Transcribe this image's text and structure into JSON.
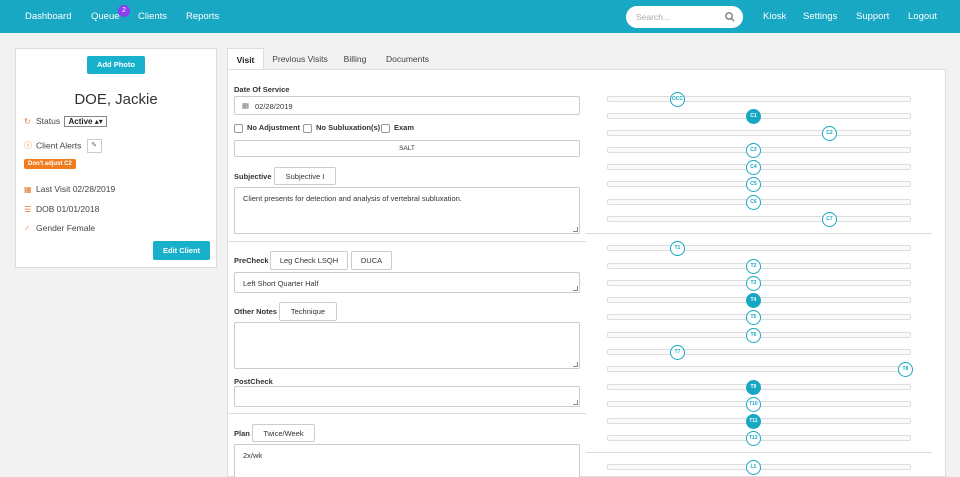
{
  "nav": {
    "items": [
      "Dashboard",
      "Queue",
      "Clients",
      "Reports",
      "Kiosk",
      "Settings",
      "Support",
      "Logout"
    ],
    "queue_badge": "2",
    "search_placeholder": "Search..."
  },
  "client": {
    "add_photo": "Add Photo",
    "name": "DOE, Jackie",
    "status_label": "Status",
    "status_value": "Active",
    "alerts_label": "Client Alerts",
    "alert_badge": "Don't adjust C2",
    "last_visit": "Last Visit 02/28/2019",
    "dob": "DOB 01/01/2018",
    "gender": "Gender Female",
    "edit_button": "Edit Client"
  },
  "tabs": [
    "Visit",
    "Previous Visits",
    "Billing",
    "Documents"
  ],
  "visit": {
    "date_label": "Date Of Service",
    "date_value": "02/28/2019",
    "checkboxes": [
      "No Adjustment",
      "No Subluxation(s)",
      "Exam"
    ],
    "salt": "SALT",
    "subjective_label": "Subjective",
    "subjective_button": "Subjective I",
    "subjective_text": "Client presents for detection and analysis of vertebral subluxation.",
    "precheck_label": "PreCheck",
    "precheck_buttons": [
      "Leg Check LSQH",
      "DUCA"
    ],
    "precheck_text": "Left Short Quarter Half",
    "other_label": "Other Notes",
    "other_button": "Technique",
    "postcheck_label": "PostCheck",
    "plan_label": "Plan",
    "plan_button": "Twice/Week",
    "plan_text": "2x/wk"
  },
  "spine": [
    {
      "label": "OCC",
      "pos": 0.23,
      "filled": false
    },
    {
      "label": "C1",
      "pos": 0.48,
      "filled": true
    },
    {
      "label": "C2",
      "pos": 0.73,
      "filled": false
    },
    {
      "label": "C3",
      "pos": 0.48,
      "filled": false
    },
    {
      "label": "C4",
      "pos": 0.48,
      "filled": false
    },
    {
      "label": "C5",
      "pos": 0.48,
      "filled": false
    },
    {
      "label": "C6",
      "pos": 0.48,
      "filled": false
    },
    {
      "label": "C7",
      "pos": 0.73,
      "filled": false
    },
    {
      "label": "T1",
      "pos": 0.23,
      "filled": false
    },
    {
      "label": "T2",
      "pos": 0.48,
      "filled": false
    },
    {
      "label": "T3",
      "pos": 0.48,
      "filled": false
    },
    {
      "label": "T4",
      "pos": 0.48,
      "filled": true
    },
    {
      "label": "T5",
      "pos": 0.48,
      "filled": false
    },
    {
      "label": "T6",
      "pos": 0.48,
      "filled": false
    },
    {
      "label": "T7",
      "pos": 0.23,
      "filled": false
    },
    {
      "label": "T8",
      "pos": 0.98,
      "filled": false
    },
    {
      "label": "T9",
      "pos": 0.48,
      "filled": true
    },
    {
      "label": "T10",
      "pos": 0.48,
      "filled": false
    },
    {
      "label": "T11",
      "pos": 0.48,
      "filled": true
    },
    {
      "label": "T12",
      "pos": 0.48,
      "filled": false
    },
    {
      "label": "L1",
      "pos": 0.48,
      "filled": false
    }
  ]
}
